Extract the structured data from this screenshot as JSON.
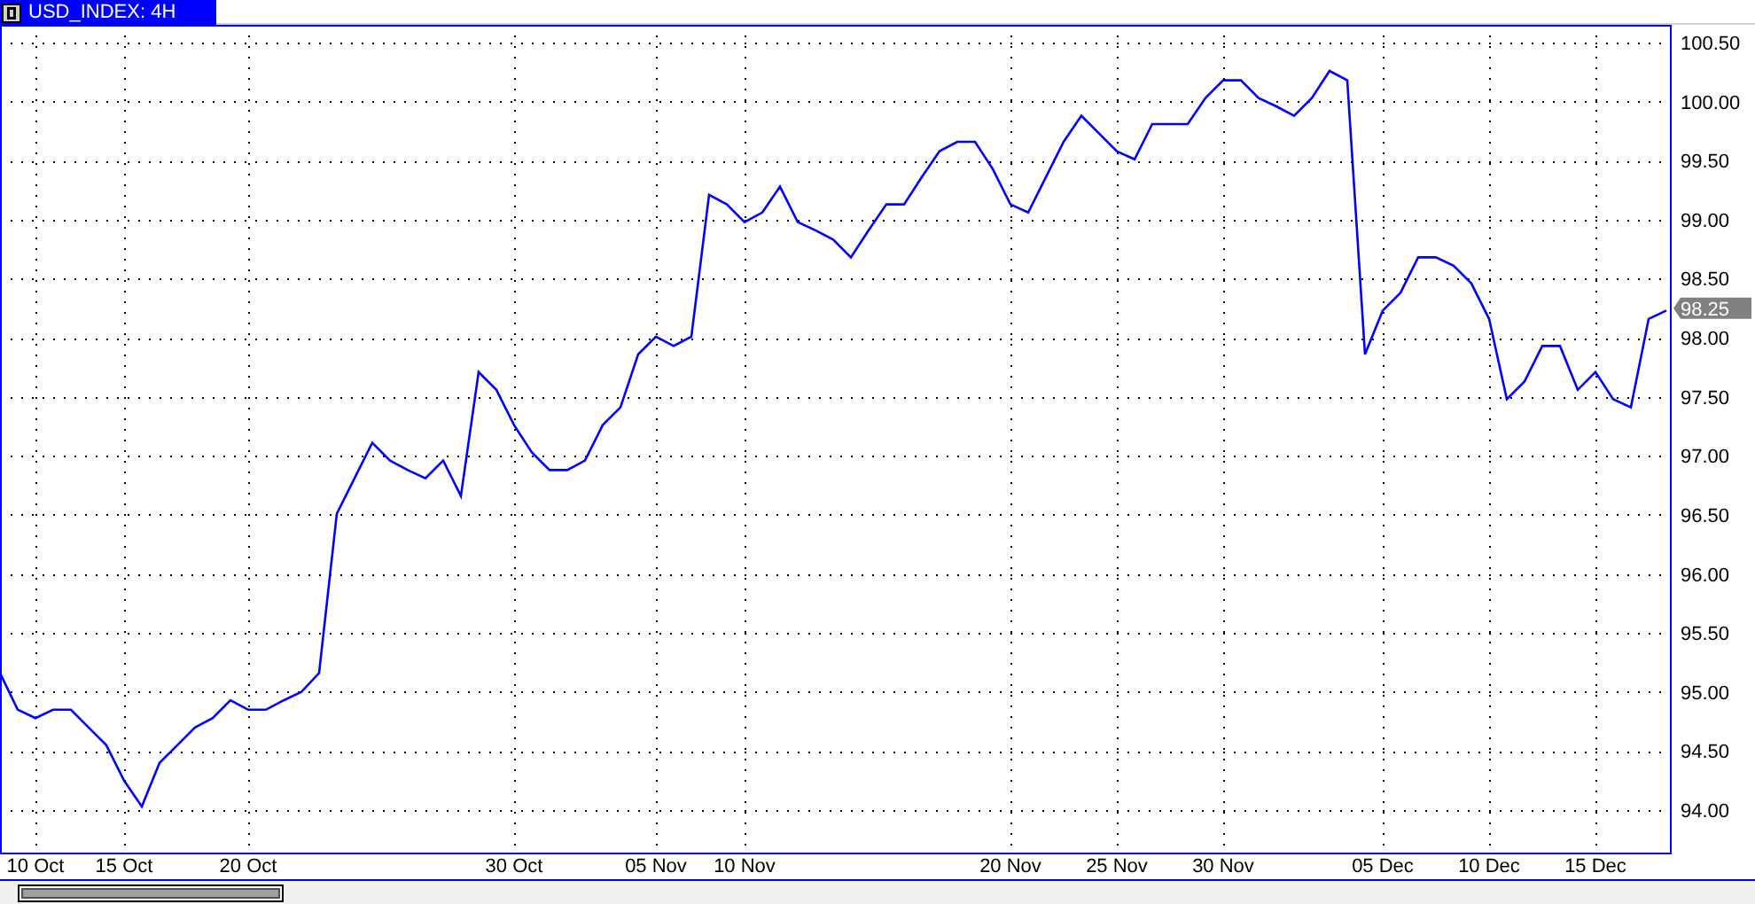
{
  "window": {
    "title": "USD_INDEX: 4H"
  },
  "chart": {
    "last_price": "98.25",
    "chart_data": {
      "type": "line",
      "grid": true,
      "ylim": [
        93.64,
        100.65
      ],
      "yticks": [
        {
          "value": 94,
          "label": "94.00"
        },
        {
          "value": 94.5,
          "label": "94.50"
        },
        {
          "value": 95,
          "label": "95.00"
        },
        {
          "value": 95.5,
          "label": "95.50"
        },
        {
          "value": 96,
          "label": "96.00"
        },
        {
          "value": 96.5,
          "label": "96.50"
        },
        {
          "value": 97,
          "label": "97.00"
        },
        {
          "value": 97.5,
          "label": "97.50"
        },
        {
          "value": 98,
          "label": "98.00"
        },
        {
          "value": 98.5,
          "label": "98.50"
        },
        {
          "value": 99,
          "label": "99.00"
        },
        {
          "value": 99.5,
          "label": "99.50"
        },
        {
          "value": 100,
          "label": "100.00"
        },
        {
          "value": 100.5,
          "label": "100.50"
        }
      ],
      "categories": [
        null,
        null,
        "10 Oct",
        null,
        null,
        null,
        null,
        "15 Oct",
        null,
        null,
        null,
        null,
        null,
        null,
        "20 Oct",
        null,
        null,
        null,
        null,
        null,
        null,
        null,
        null,
        null,
        null,
        null,
        null,
        null,
        null,
        "30 Oct",
        null,
        null,
        null,
        null,
        null,
        null,
        null,
        "05 Nov",
        null,
        null,
        null,
        null,
        "10 Nov",
        null,
        null,
        null,
        null,
        null,
        null,
        null,
        null,
        null,
        null,
        null,
        null,
        null,
        null,
        "20 Nov",
        null,
        null,
        null,
        null,
        null,
        "25 Nov",
        null,
        null,
        null,
        null,
        null,
        "30 Nov",
        null,
        null,
        null,
        null,
        null,
        null,
        null,
        null,
        "05 Dec",
        null,
        null,
        null,
        null,
        null,
        "10 Dec",
        null,
        null,
        null,
        null,
        null,
        "15 Dec",
        null,
        null,
        null,
        null
      ],
      "series": [
        {
          "color": "#0000ff",
          "values": [
            95.16,
            94.85,
            94.78,
            94.85,
            94.85,
            94.7,
            94.55,
            94.25,
            94.03,
            94.4,
            94.55,
            94.7,
            94.78,
            94.93,
            94.85,
            94.85,
            94.93,
            95.0,
            95.16,
            96.51,
            96.81,
            97.11,
            96.96,
            96.88,
            96.81,
            96.96,
            96.66,
            97.71,
            97.56,
            97.26,
            97.03,
            96.88,
            96.88,
            96.96,
            97.26,
            97.41,
            97.86,
            98.01,
            97.93,
            98.01,
            99.21,
            99.13,
            98.98,
            99.06,
            99.28,
            98.98,
            98.91,
            98.83,
            98.68,
            98.91,
            99.13,
            99.13,
            99.36,
            99.58,
            99.66,
            99.66,
            99.43,
            99.13,
            99.06,
            99.36,
            99.66,
            99.88,
            99.73,
            99.58,
            99.51,
            99.81,
            99.81,
            99.81,
            100.03,
            100.18,
            100.18,
            100.03,
            99.96,
            99.88,
            100.03,
            100.26,
            100.18,
            97.86,
            98.23,
            98.38,
            98.68,
            98.68,
            98.61,
            98.46,
            98.16,
            97.48,
            97.63,
            97.93,
            97.93,
            97.56,
            97.71,
            97.48,
            97.41,
            98.16,
            98.23
          ]
        }
      ]
    }
  }
}
